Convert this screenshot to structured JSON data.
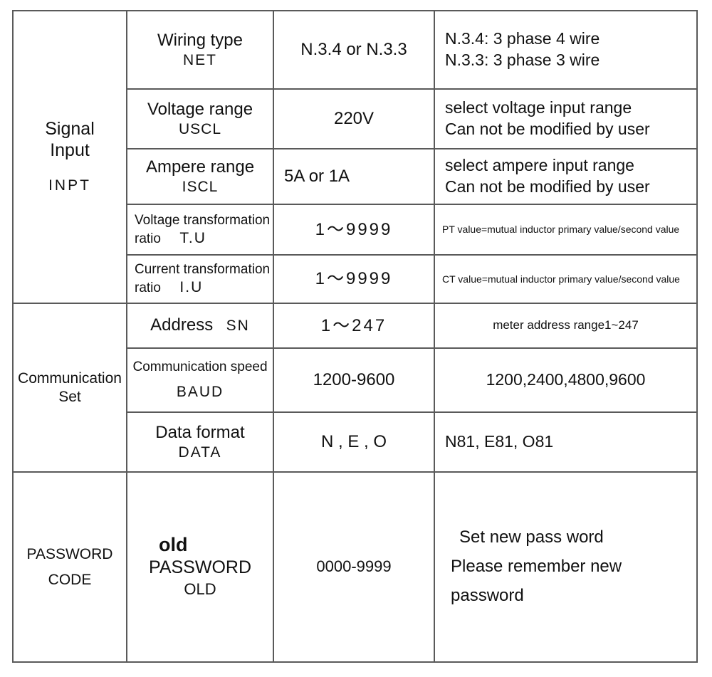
{
  "table": {
    "column_count": 4,
    "sections": [
      {
        "group_name_line1": "Signal",
        "group_name_line2": "Input",
        "group_code": "INPT",
        "rows": [
          {
            "param_name": "Wiring type",
            "param_code": "NET",
            "value": "N.3.4 or N.3.3",
            "desc_line1": "N.3.4: 3 phase 4 wire",
            "desc_line2": "N.3.3: 3 phase 3 wire"
          },
          {
            "param_name": "Voltage range",
            "param_code": "USCL",
            "value": "220V",
            "desc_line1": "select voltage input range",
            "desc_line2": "Can not be modified by user"
          },
          {
            "param_name": "Ampere range",
            "param_code": "ISCL",
            "value": "5A or 1A",
            "desc_line1": "select ampere input range",
            "desc_line2": "Can not be modified by user"
          },
          {
            "param_name_line1": "Voltage  transformation",
            "param_name_line2": "ratio",
            "param_code": "T.U",
            "value": "1～9999",
            "desc_line1": "PT value=mutual inductor primary value/second value"
          },
          {
            "param_name_line1": "Current  transformation",
            "param_name_line2": "ratio",
            "param_code": "I.U",
            "value": "1～9999",
            "desc_line1": "CT value=mutual inductor primary value/second value"
          }
        ]
      },
      {
        "group_name_line1": "Communication",
        "group_name_line2": "Set",
        "rows": [
          {
            "param_name": "Address",
            "param_code": "SN",
            "value": "1～247",
            "desc_line1": "meter address range1~247"
          },
          {
            "param_name": "Communication speed",
            "param_code": "BAUD",
            "value": "1200-9600",
            "desc_line1": "1200,2400,4800,9600"
          },
          {
            "param_name": "Data  format",
            "param_code": "DATA",
            "value": "N , E , O",
            "desc_line1": "N81, E81, O81"
          }
        ]
      },
      {
        "group_name_line1": "PASSWORD",
        "group_name_line2": "CODE",
        "rows": [
          {
            "param_name_bold": "old",
            "param_name": "PASSWORD",
            "param_code": "OLD",
            "value": "0000-9999",
            "desc_line1": "Set new pass word",
            "desc_line2": "Please remember new",
            "desc_line3": "password"
          }
        ]
      }
    ]
  },
  "colors": {
    "border": "#5a5a5a",
    "text": "#111111",
    "background": "#ffffff"
  }
}
